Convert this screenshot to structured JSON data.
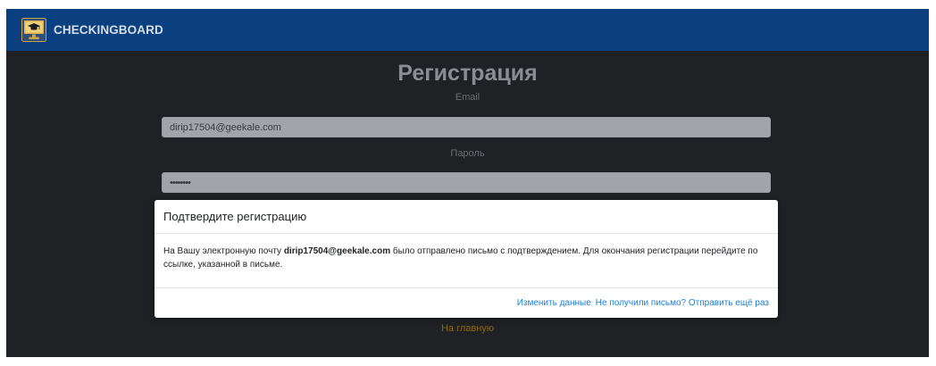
{
  "navbar": {
    "brand_text": "CHECKINGBOARD",
    "logo_icon": "monitor-graduation-cap-icon",
    "background_color": "#0a3f80"
  },
  "registration_form": {
    "title": "Регистрация",
    "email_label": "Email",
    "email_value": "dirip17504@geekale.com",
    "password_label": "Пароль",
    "password_value": "••••••••",
    "home_link": "На главную"
  },
  "modal": {
    "title": "Подтвердите регистрацию",
    "body_prefix": "На Вашу электронную почту ",
    "body_email": "dirip17504@geekale.com",
    "body_suffix": " было отправлено письмо с подтверждением. Для окончания регистрации перейдите по ссылке, указанной в письме.",
    "change_data_link": "Изменить данные",
    "resend_link": "Не получили письмо? Отправить ещё раз",
    "link_color": "#1a7fd9"
  }
}
